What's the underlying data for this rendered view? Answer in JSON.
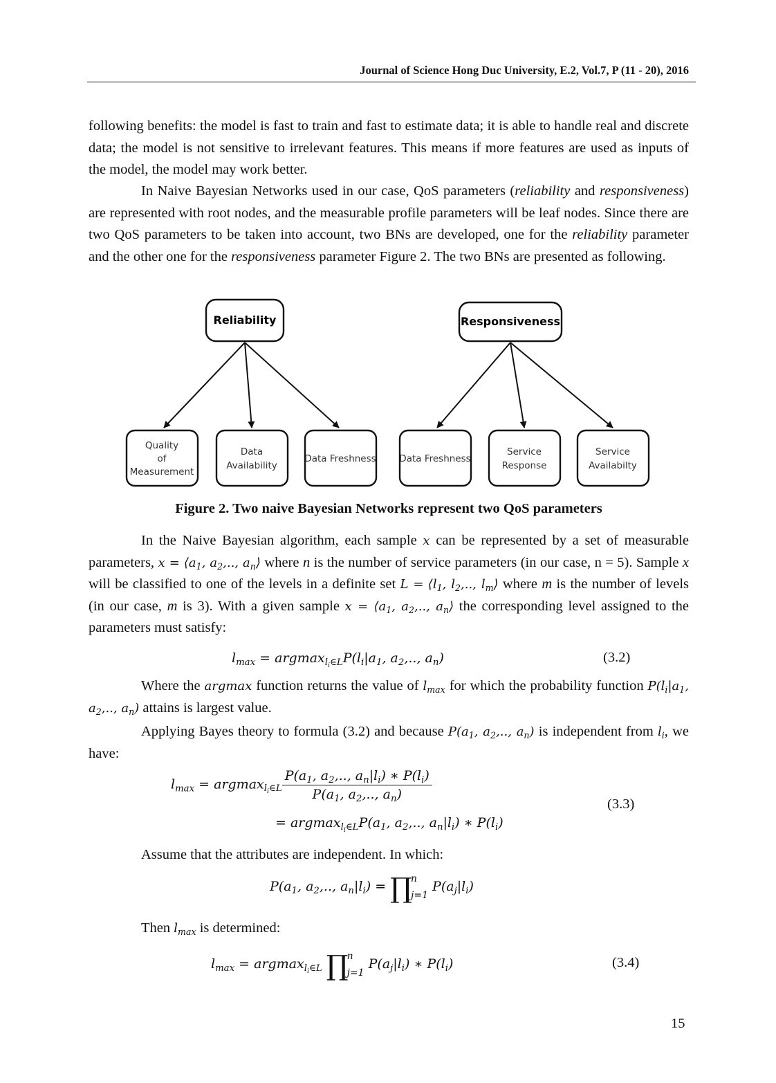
{
  "header": {
    "journal": "Journal of Science Hong Duc University, E.2, Vol.7, P (11 - 20), 2016"
  },
  "paragraphs": {
    "p1": "following benefits: the model is fast to train and fast to estimate data; it is able to handle real and discrete data; the model is not sensitive to irrelevant features. This means if more features are used as inputs of the model, the model may work better.",
    "p2_a": "In Naive Bayesian Networks used in our case, QoS parameters (",
    "p2_reliability": "reliability",
    "p2_b": " and ",
    "p2_responsiveness": "responsiveness",
    "p2_c": ") are represented with root nodes, and the measurable profile parameters will be leaf nodes. Since there are two QoS parameters to be taken into account, two BNs are developed, one for the ",
    "p2_d": " parameter and the other one for the ",
    "p2_e": " parameter Figure 2. The two BNs are presented as following.",
    "p3_a": "In the Naive Bayesian algorithm, each sample ",
    "p3_b": " can be represented by a set of measurable parameters, ",
    "p3_c": " where ",
    "p3_d": " is the number of service parameters (in our case, n = 5). Sample ",
    "p3_e": " will be classified to one of the levels in a definite set ",
    "p3_f": " where ",
    "p3_g": " is the number of levels (in our case, ",
    "p3_h": " is 3). With a given sample ",
    "p3_i": " the corresponding level assigned to the parameters must satisfy:",
    "p4_a": "Where the ",
    "p4_b": " function returns the value of ",
    "p4_c": " for which the probability function ",
    "p4_d": " attains is largest value.",
    "p5_a": "Applying Bayes theory to formula (3.2) and because ",
    "p5_b": " is independent from ",
    "p5_c": ", we have:",
    "p6": "Assume that the attributes are independent. In which:",
    "p7_a": "Then ",
    "p7_b": " is determined:"
  },
  "math": {
    "x": "x",
    "n": "n",
    "m": "m",
    "L_eq": "L =",
    "argmax": "argmax",
    "l": "l",
    "max": "max",
    "li": "l",
    "i": "i"
  },
  "figure": {
    "caption": "Figure 2. Two naive Bayesian Networks represent two QoS parameters",
    "networks": [
      {
        "root": "Reliability",
        "leaves": [
          [
            "Quality",
            "of",
            "Measurement"
          ],
          [
            "Data",
            "Availability"
          ],
          [
            "Data Freshness"
          ]
        ]
      },
      {
        "root": "Responsiveness",
        "leaves": [
          [
            "Data Freshness"
          ],
          [
            "Service",
            "Response"
          ],
          [
            "Service",
            "Availabilty"
          ]
        ]
      }
    ]
  },
  "equations": {
    "eq32_number": "(3.2)",
    "eq33_number": "(3.3)",
    "eq34_number": "(3.4)"
  },
  "page_number": "15"
}
